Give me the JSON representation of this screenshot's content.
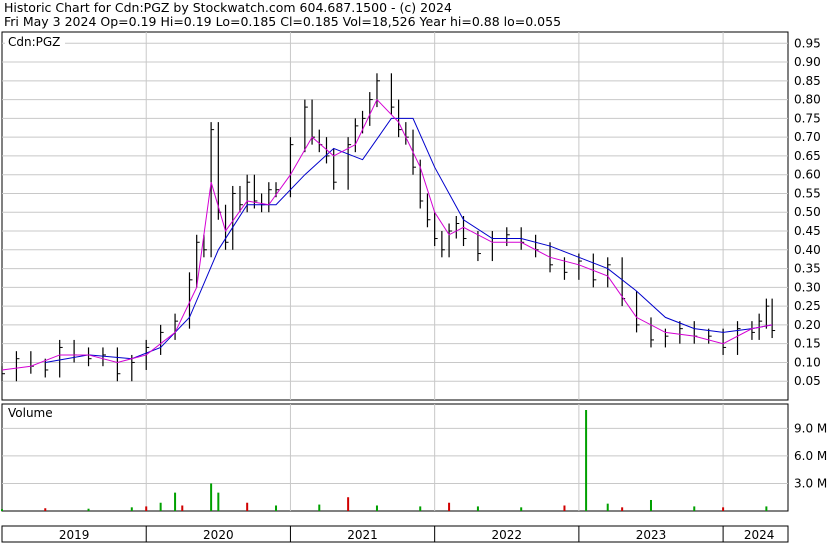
{
  "header": {
    "line1": "Historic Chart for Cdn:PGZ by Stockwatch.com 604.687.1500 - (c) 2024",
    "line2": "Fri May  3 2024   Op=0.19  Hi=0.19  Lo=0.185  Cl=0.185  Vol=18,526  Year hi=0.88  lo=0.055"
  },
  "colors": {
    "background": "#ffffff",
    "grid": "#c8c8c8",
    "price_bars": "#000000",
    "ma_fast": "#d400d4",
    "ma_slow": "#0000cc",
    "volume_up": "#00a000",
    "volume_down": "#d00000"
  },
  "chart_data": [
    {
      "type": "line",
      "panel": "price",
      "title": "Cdn:PGZ",
      "ylim": [
        0.0,
        0.98
      ],
      "yticks": [
        "0.05",
        "0.10",
        "0.15",
        "0.20",
        "0.25",
        "0.30",
        "0.35",
        "0.40",
        "0.45",
        "0.50",
        "0.55",
        "0.60",
        "0.65",
        "0.70",
        "0.75",
        "0.80",
        "0.85",
        "0.90",
        "0.95"
      ],
      "xlim": [
        2019.0,
        2024.45
      ],
      "year_labels": [
        "2019",
        "2020",
        "2021",
        "2022",
        "2023",
        "2024"
      ],
      "grid": true,
      "series": [
        {
          "style": "price-bars",
          "x": [
            2019.0,
            2019.1,
            2019.2,
            2019.3,
            2019.4,
            2019.5,
            2019.6,
            2019.7,
            2019.8,
            2019.9,
            2020.0,
            2020.1,
            2020.2,
            2020.3,
            2020.35,
            2020.4,
            2020.45,
            2020.5,
            2020.55,
            2020.6,
            2020.65,
            2020.7,
            2020.75,
            2020.8,
            2020.85,
            2020.9,
            2021.0,
            2021.1,
            2021.15,
            2021.2,
            2021.25,
            2021.3,
            2021.4,
            2021.45,
            2021.5,
            2021.55,
            2021.6,
            2021.7,
            2021.75,
            2021.8,
            2021.85,
            2021.9,
            2021.95,
            2022.0,
            2022.05,
            2022.1,
            2022.15,
            2022.2,
            2022.3,
            2022.4,
            2022.5,
            2022.6,
            2022.7,
            2022.8,
            2022.9,
            2023.0,
            2023.1,
            2023.2,
            2023.3,
            2023.4,
            2023.5,
            2023.6,
            2023.7,
            2023.8,
            2023.9,
            2024.0,
            2024.1,
            2024.2,
            2024.25,
            2024.3,
            2024.34
          ],
          "values": [
            0.07,
            0.11,
            0.09,
            0.08,
            0.14,
            0.12,
            0.11,
            0.12,
            0.07,
            0.1,
            0.14,
            0.18,
            0.21,
            0.32,
            0.42,
            0.4,
            0.72,
            0.5,
            0.42,
            0.55,
            0.52,
            0.58,
            0.53,
            0.52,
            0.56,
            0.56,
            0.68,
            0.78,
            0.7,
            0.68,
            0.65,
            0.58,
            0.68,
            0.73,
            0.75,
            0.8,
            0.85,
            0.78,
            0.72,
            0.7,
            0.62,
            0.53,
            0.48,
            0.43,
            0.4,
            0.45,
            0.47,
            0.43,
            0.39,
            0.43,
            0.44,
            0.42,
            0.4,
            0.36,
            0.34,
            0.37,
            0.32,
            0.36,
            0.27,
            0.2,
            0.16,
            0.17,
            0.19,
            0.17,
            0.17,
            0.14,
            0.19,
            0.18,
            0.21,
            0.25,
            0.185
          ]
        },
        {
          "style": "moving-average-fast",
          "x": [
            2019.0,
            2019.2,
            2019.4,
            2019.6,
            2019.8,
            2020.0,
            2020.2,
            2020.35,
            2020.45,
            2020.55,
            2020.7,
            2020.85,
            2021.0,
            2021.15,
            2021.3,
            2021.45,
            2021.6,
            2021.75,
            2021.9,
            2022.0,
            2022.1,
            2022.2,
            2022.4,
            2022.6,
            2022.8,
            2023.0,
            2023.2,
            2023.4,
            2023.6,
            2023.8,
            2024.0,
            2024.2,
            2024.34
          ],
          "values": [
            0.08,
            0.09,
            0.12,
            0.12,
            0.1,
            0.12,
            0.18,
            0.3,
            0.58,
            0.45,
            0.53,
            0.52,
            0.6,
            0.7,
            0.65,
            0.68,
            0.8,
            0.74,
            0.62,
            0.5,
            0.44,
            0.46,
            0.42,
            0.42,
            0.38,
            0.36,
            0.33,
            0.22,
            0.18,
            0.17,
            0.15,
            0.19,
            0.2
          ]
        },
        {
          "style": "moving-average-slow",
          "x": [
            2019.3,
            2019.6,
            2019.9,
            2020.1,
            2020.3,
            2020.5,
            2020.7,
            2020.9,
            2021.1,
            2021.3,
            2021.5,
            2021.7,
            2021.85,
            2022.0,
            2022.2,
            2022.4,
            2022.6,
            2022.8,
            2023.0,
            2023.2,
            2023.4,
            2023.6,
            2023.8,
            2024.0,
            2024.2,
            2024.34
          ],
          "values": [
            0.1,
            0.12,
            0.11,
            0.14,
            0.22,
            0.4,
            0.52,
            0.52,
            0.6,
            0.67,
            0.64,
            0.75,
            0.75,
            0.62,
            0.48,
            0.43,
            0.43,
            0.41,
            0.38,
            0.35,
            0.29,
            0.22,
            0.19,
            0.18,
            0.19,
            0.2
          ]
        }
      ]
    },
    {
      "type": "bar",
      "panel": "volume",
      "title": "Volume",
      "ylim": [
        0,
        11000000
      ],
      "yticks": [
        "3.0 M",
        "6.0 M",
        "9.0 M"
      ],
      "x": [
        2019.0,
        2019.3,
        2019.6,
        2019.9,
        2020.0,
        2020.1,
        2020.2,
        2020.25,
        2020.45,
        2020.5,
        2020.7,
        2020.9,
        2021.2,
        2021.4,
        2021.6,
        2021.9,
        2022.1,
        2022.3,
        2022.6,
        2022.9,
        2023.05,
        2023.2,
        2023.3,
        2023.5,
        2023.8,
        2024.0,
        2024.3
      ],
      "values": [
        200000,
        300000,
        250000,
        400000,
        500000,
        900000,
        2000000,
        600000,
        3000000,
        2000000,
        900000,
        600000,
        700000,
        1500000,
        600000,
        500000,
        900000,
        500000,
        400000,
        600000,
        11000000,
        800000,
        400000,
        1200000,
        500000,
        400000,
        500000
      ]
    }
  ]
}
